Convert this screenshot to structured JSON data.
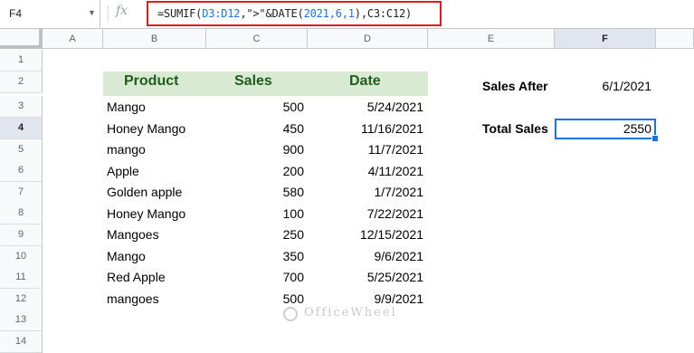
{
  "name_box": "F4",
  "formula": {
    "prefix": "=SUMIF(",
    "ref1": "D3:D12",
    "mid1": ",\">\"&DATE(",
    "nums": "2021,6,1",
    "mid2": "),",
    "ref2": "C3:C12",
    "suffix": ")"
  },
  "columns": [
    "A",
    "B",
    "C",
    "D",
    "E",
    "F"
  ],
  "rows": [
    "1",
    "2",
    "3",
    "4",
    "5",
    "6",
    "7",
    "8",
    "9",
    "10",
    "11",
    "12",
    "13",
    "14"
  ],
  "table": {
    "headers": [
      "Product",
      "Sales",
      "Date"
    ],
    "data": [
      [
        "Mango",
        "500",
        "5/24/2021"
      ],
      [
        "Honey Mango",
        "450",
        "11/16/2021"
      ],
      [
        "mango",
        "900",
        "11/7/2021"
      ],
      [
        "Apple",
        "200",
        "4/11/2021"
      ],
      [
        "Golden apple",
        "580",
        "1/7/2021"
      ],
      [
        "Honey Mango",
        "100",
        "7/22/2021"
      ],
      [
        "Mangoes",
        "250",
        "12/15/2021"
      ],
      [
        "Mango",
        "350",
        "9/6/2021"
      ],
      [
        "Red Apple",
        "700",
        "5/25/2021"
      ],
      [
        "mangoes",
        "500",
        "9/9/2021"
      ]
    ]
  },
  "summary": {
    "sales_after_label": "Sales After",
    "sales_after_value": "6/1/2021",
    "total_label": "Total Sales",
    "total_value": "2550"
  },
  "watermark": "OfficeWheel",
  "colors": {
    "header_fill": "#d9ead3",
    "header_text": "#1f5c1f",
    "formula_highlight": "#e31b1b",
    "selection": "#1a73e8"
  }
}
